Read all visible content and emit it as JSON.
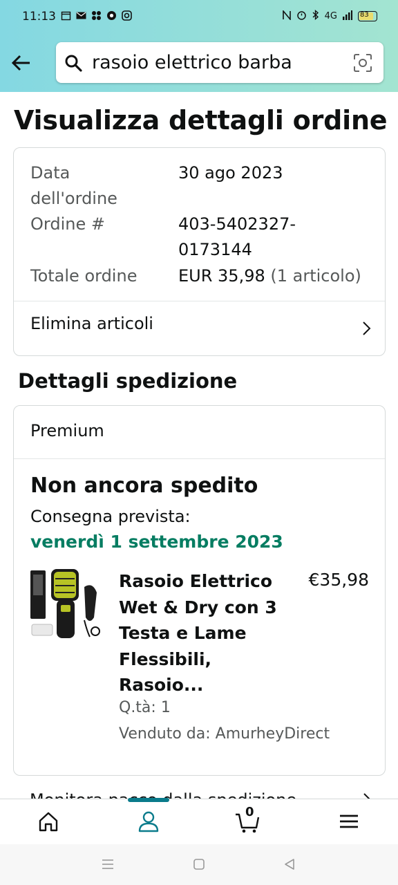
{
  "status_bar": {
    "time": "11:13",
    "battery": "83",
    "network": "4G"
  },
  "header": {
    "back_icon": "arrow-left-icon",
    "search_value": "rasoio elettrico barba",
    "search_icon": "search-icon",
    "camera_icon": "camera-scan-icon"
  },
  "page": {
    "title": "Visualizza dettagli ordine"
  },
  "order_summary": {
    "date_label": "Data dell'ordine",
    "date_value": "30 ago 2023",
    "number_label": "Ordine #",
    "number_value": "403-5402327-0173144",
    "total_label": "Totale ordine",
    "total_value": "EUR 35,98",
    "total_count": "(1 articolo)",
    "delete_items": "Elimina articoli"
  },
  "shipment": {
    "section_title": "Dettagli spedizione",
    "service": "Premium",
    "status": "Non ancora spedito",
    "delivery_label": "Consegna prevista:",
    "delivery_date": "venerdì 1 settembre 2023",
    "delivery_color": "#067d62",
    "product": {
      "name": "Rasoio Elettrico Wet & Dry con 3 Testa e Lame Flessibili, Rasoio...",
      "price": "€35,98",
      "qty": "Q.tà: 1",
      "seller": "Venduto da: AmurheyDirect"
    }
  },
  "peek_row": {
    "label": "Monitora pacco dalla spedizione"
  },
  "bottom_nav": {
    "items": [
      "home",
      "account",
      "cart",
      "menu"
    ],
    "cart_count": "0",
    "accent": "#0a7b8b"
  }
}
